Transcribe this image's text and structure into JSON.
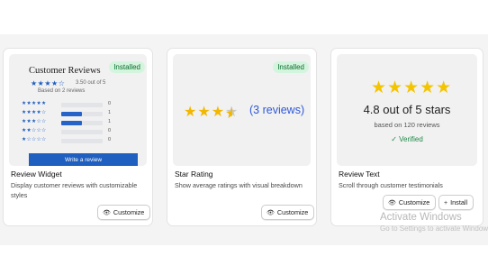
{
  "cards": [
    {
      "title": "Review Widget",
      "description": "Display customer reviews with customizable styles",
      "badge": "Installed",
      "customize_label": "Customize",
      "preview": {
        "heading": "Customer Reviews",
        "stars": "★★★★☆",
        "score": "3.50 out of 5",
        "based_on": "Based on 2 reviews",
        "rows": [
          {
            "stars": "★★★★★",
            "fraction": 0.0,
            "count": "0"
          },
          {
            "stars": "★★★★☆",
            "fraction": 0.5,
            "count": "1"
          },
          {
            "stars": "★★★☆☆",
            "fraction": 0.5,
            "count": "1"
          },
          {
            "stars": "★★☆☆☆",
            "fraction": 0.0,
            "count": "0"
          },
          {
            "stars": "★☆☆☆☆",
            "fraction": 0.0,
            "count": "0"
          }
        ],
        "write_button": "Write a review"
      }
    },
    {
      "title": "Star Rating",
      "description": "Show average ratings with visual breakdown",
      "badge": "Installed",
      "customize_label": "Customize",
      "preview": {
        "rating": 3.5,
        "reviews_text": "(3 reviews)"
      }
    },
    {
      "title": "Review Text",
      "description": "Scroll through customer testimonials",
      "customize_label": "Customize",
      "install_label": "Install",
      "preview": {
        "stars": "★★★★★",
        "headline": "4.8 out of 5 stars",
        "based_on": "based on 120 reviews",
        "verified": "✓ Verified"
      }
    }
  ],
  "watermark": {
    "line1": "Activate Windows",
    "line2": "Go to Settings to activate Windows."
  },
  "colors": {
    "accent_blue": "#1f5fbf",
    "star_gold": "#f2b700",
    "installed_bg": "#d4f5dd",
    "verified_green": "#1e8a46"
  }
}
